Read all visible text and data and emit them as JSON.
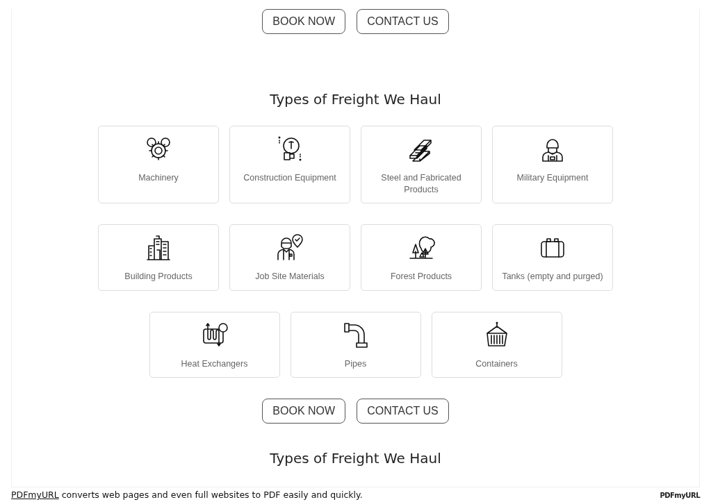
{
  "top_buttons": [
    "BOOK NOW",
    "CONTACT US"
  ],
  "section": {
    "title": "Types of Freight We Haul",
    "rows": [
      [
        "Machinery",
        "Construction Equipment",
        "Steel and Fabricated Products",
        "Military Equipment"
      ],
      [
        "Building Products",
        "Job Site Materials",
        "Forest Products",
        "Tanks (empty and purged)"
      ],
      [
        "Heat Exchangers",
        "Pipes",
        "Containers"
      ]
    ],
    "buttons": [
      "BOOK NOW",
      "CONTACT US"
    ]
  },
  "next_title": "Types of Freight We Haul",
  "footer": {
    "link": "PDFmyURL",
    "text": "converts web pages and even full websites to PDF easily and quickly.",
    "logo": "PDFmyURL"
  }
}
